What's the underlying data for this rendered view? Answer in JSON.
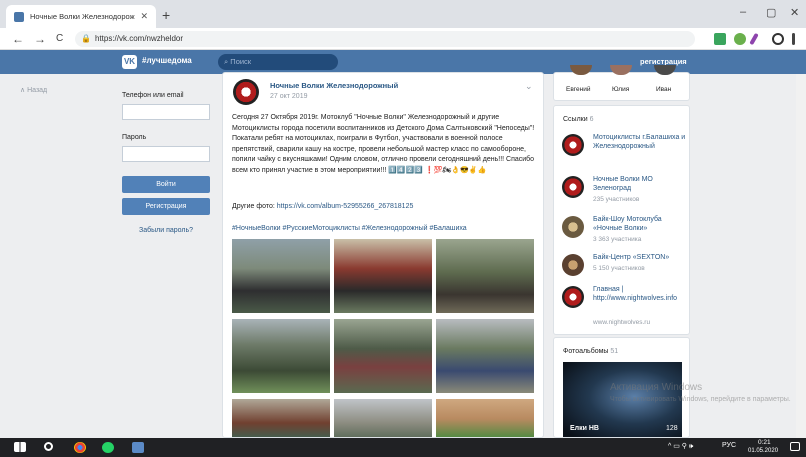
{
  "browser": {
    "tab_title": "Ночные Волки Железнодорож",
    "tab_close": "✕",
    "new_tab": "+",
    "url": "https://vk.com/nwzheldor",
    "nav": {
      "back": "←",
      "forward": "→",
      "reload": "C"
    },
    "window": {
      "minimize": "–",
      "maximize": "▢",
      "close": "✕"
    }
  },
  "vk": {
    "logo_letter": "VK",
    "brand": "#лучшедома",
    "search_placeholder": "Поиск",
    "register": "регистрация",
    "back_link": "Назад"
  },
  "login": {
    "phone_label": "Телефон или email",
    "password_label": "Пароль",
    "login_button": "Войти",
    "register_button": "Регистрация",
    "forgot": "Забыли пароль?"
  },
  "post": {
    "author": "Ночные Волки Железнодорожный",
    "date": "27 окт 2019",
    "text": "Сегодня 27 Октября 2019г. Мотоклуб \"Ночные Волки\" Железнодорожный и другие Мотоциклисты города посетили воспитанников из Детского Дома Салтыковский \"Непоседы\"! Покатали ребят на мотоциклах, поиграли в Футбол, участвовали в военной полосе препятствий, сварили кашу на костре, провели небольшой мастер класс по самообороне, попили чайку с вкусняшками! Одним словом, отлично провели сегодняшний день!!! Спасибо всем кто принял участие в этом мероприятии!!! 1️⃣4️⃣2️⃣3️⃣ ❗💯🏍👌😎✌👍",
    "other_label": "Другие фото: ",
    "other_link": "https://vk.com/album-52955266_267818125",
    "tags": "#НочныеВолки #РусскиеМотоциклисты #Железнодорожный #Балашиха"
  },
  "members": [
    "Евгений",
    "Юлия",
    "Иван"
  ],
  "links": {
    "title": "Ссылки",
    "count": "6",
    "items": [
      {
        "name": "Мотоциклисты г.Балашиха и Железнодорожный",
        "sub": ""
      },
      {
        "name": "Ночные Волки МО Зеленоград",
        "sub": "235 участников"
      },
      {
        "name": "Байк-Шоу Мотоклуба «Ночные Волки»",
        "sub": "3 363 участника"
      },
      {
        "name": "Байк-Центр «SEXTON»",
        "sub": "5 150 участников"
      },
      {
        "name": "Главная | http://www.nightwolves.info",
        "sub": "www.nightwolves.ru"
      }
    ]
  },
  "albums": {
    "title": "Фотоальбомы",
    "count": "51",
    "album_name": "Елки НВ",
    "album_count": "128"
  },
  "watermark": {
    "line1": "Активация Windows",
    "line2": "Чтобы активировать Windows, перейдите в параметры."
  },
  "taskbar": {
    "lang": "РУС",
    "time": "0:21",
    "date": "01.05.2020"
  }
}
